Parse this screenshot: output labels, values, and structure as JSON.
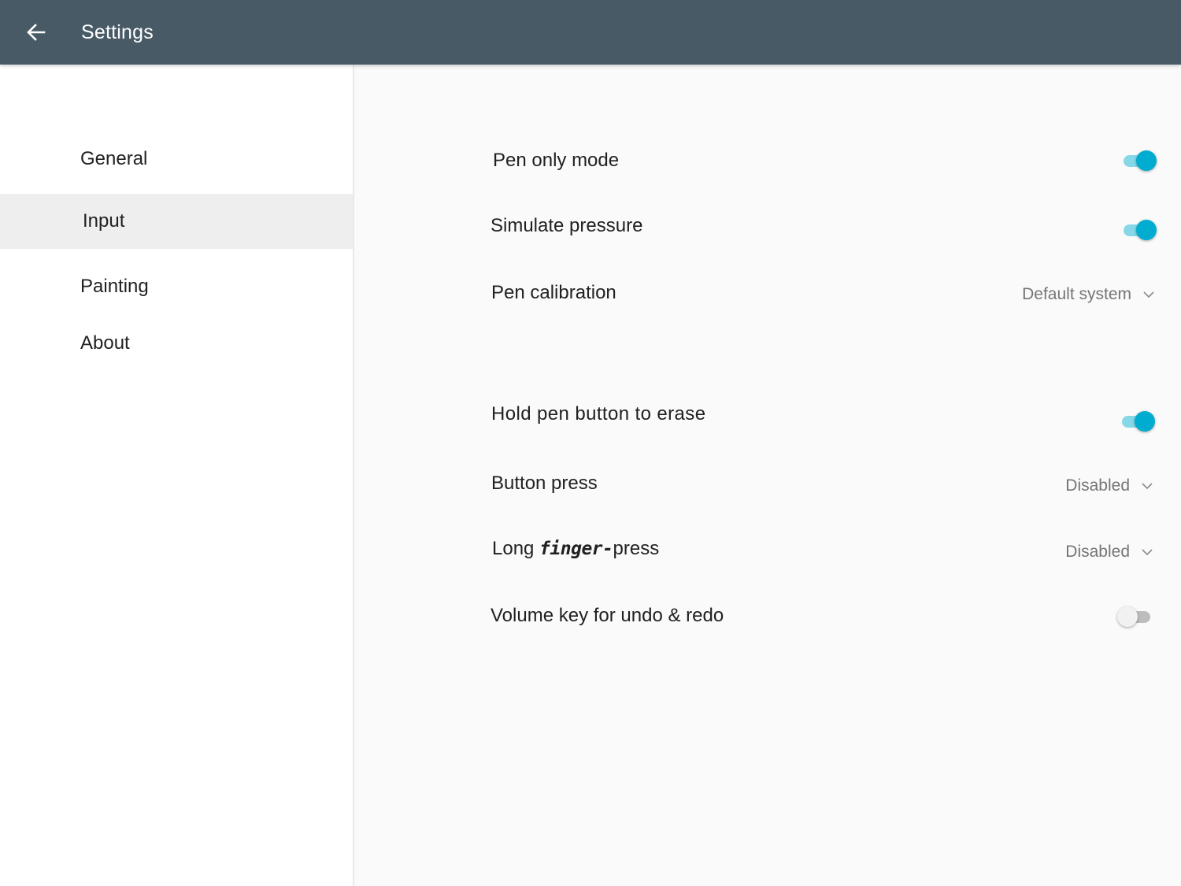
{
  "appbar": {
    "title": "Settings",
    "back_icon": "arrow-left-icon",
    "background": "#475a66"
  },
  "sidebar": {
    "items": [
      {
        "label": "General",
        "active": false
      },
      {
        "label": "Input",
        "active": true
      },
      {
        "label": "Painting",
        "active": false
      },
      {
        "label": "About",
        "active": false
      }
    ]
  },
  "settings": {
    "pen_only_mode": {
      "label": "Pen only mode",
      "enabled": true
    },
    "simulate_pressure": {
      "label": "Simulate pressure",
      "enabled": true
    },
    "pen_calibration": {
      "label": "Pen calibration",
      "value": "Default system"
    },
    "hold_pen_button_to_erase": {
      "label": "Hold pen button to erase",
      "enabled": true
    },
    "button_press": {
      "label": "Button press",
      "value": "Disabled"
    },
    "long_finger_press": {
      "label_start": "Long",
      "label_handwritten": "finger-",
      "label_end": "press",
      "value": "Disabled"
    },
    "volume_key_undo_redo": {
      "label": "Volume key for undo & redo",
      "enabled": false
    }
  },
  "colors": {
    "accent": "#00acd0",
    "accent_track": "#86d8e8",
    "selected_nav_bg": "#eeeeee"
  }
}
